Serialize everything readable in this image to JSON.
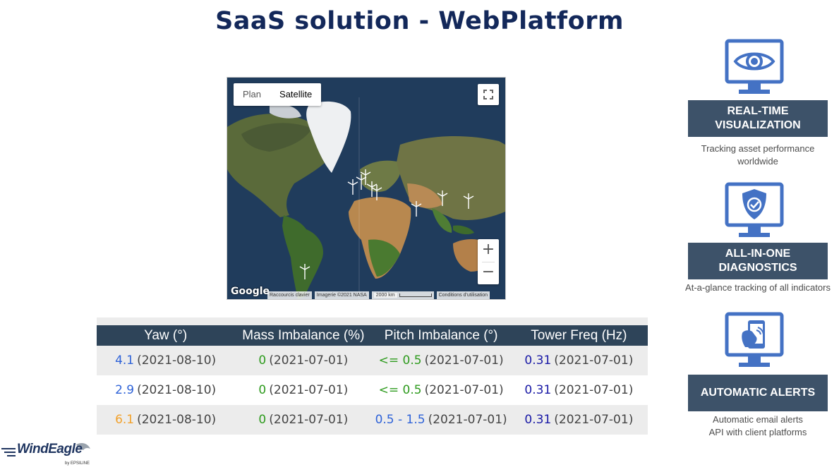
{
  "page": {
    "title": "SaaS solution - WebPlatform"
  },
  "map": {
    "tabs": [
      {
        "label": "Plan"
      },
      {
        "label": "Satellite"
      }
    ],
    "active_tab": "Satellite",
    "zoom_in": "+",
    "zoom_out": "−",
    "google": "Google",
    "attribution": {
      "shortcuts": "Raccourcis clavier",
      "imagery": "Imagerie ©2021 NASA",
      "scale": "2000 km",
      "terms": "Conditions d'utilisation"
    }
  },
  "table": {
    "headers": [
      "Yaw (°)",
      "Mass Imbalance (%)",
      "Pitch Imbalance (°)",
      "Tower Freq (Hz)"
    ],
    "rows": [
      [
        {
          "value": "4.1",
          "date": "(2021-08-10)",
          "color": "#2f63d8"
        },
        {
          "value": "0",
          "date": "(2021-07-01)",
          "color": "#2e9b1e"
        },
        {
          "value": "<= 0.5",
          "date": "(2021-07-01)",
          "color": "#2e9b1e"
        },
        {
          "value": "0.31",
          "date": "(2021-07-01)",
          "color": "#1a1aa6"
        }
      ],
      [
        {
          "value": "2.9",
          "date": "(2021-08-10)",
          "color": "#2f63d8"
        },
        {
          "value": "0",
          "date": "(2021-07-01)",
          "color": "#2e9b1e"
        },
        {
          "value": "<= 0.5",
          "date": "(2021-07-01)",
          "color": "#2e9b1e"
        },
        {
          "value": "0.31",
          "date": "(2021-07-01)",
          "color": "#1a1aa6"
        }
      ],
      [
        {
          "value": "6.1",
          "date": "(2021-08-10)",
          "color": "#f2a12b"
        },
        {
          "value": "0",
          "date": "(2021-07-01)",
          "color": "#2e9b1e"
        },
        {
          "value": "0.5 - 1.5",
          "date": "(2021-07-01)",
          "color": "#2f63d8"
        },
        {
          "value": "0.31",
          "date": "(2021-07-01)",
          "color": "#1a1aa6"
        }
      ]
    ]
  },
  "features": [
    {
      "icon": "eye-icon",
      "title_lines": [
        "REAL-TIME",
        "VISUALIZATION"
      ],
      "desc_lines": [
        "Tracking asset performance",
        "worldwide"
      ]
    },
    {
      "icon": "shield-check-icon",
      "title_lines": [
        "ALL-IN-ONE",
        "DIAGNOSTICS"
      ],
      "desc_lines": [
        "At-a-glance tracking of all indicators"
      ]
    },
    {
      "icon": "phone-alert-icon",
      "title_lines": [
        "AUTOMATIC ALERTS"
      ],
      "desc_lines": [
        "Automatic email alerts",
        "API with client platforms"
      ]
    }
  ],
  "logo": {
    "name": "WindEagle",
    "tagline": "by EPSILINE"
  },
  "colors": {
    "title": "#13285a",
    "header_bg": "#2e4459",
    "feature_bg": "#3d5269",
    "icon_blue": "#4472c4"
  }
}
